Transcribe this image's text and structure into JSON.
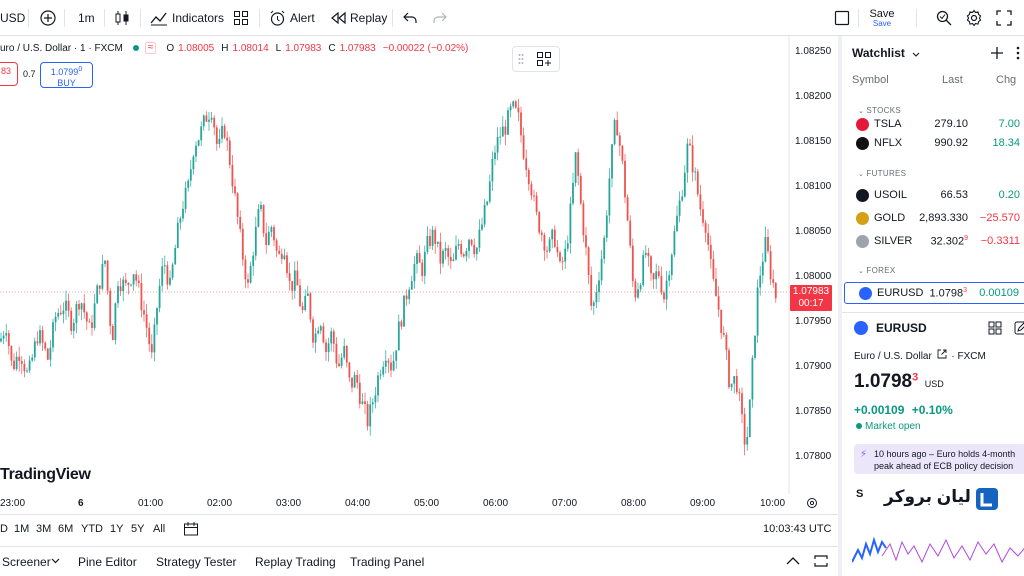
{
  "toolbar": {
    "symbol": "USD",
    "interval": "1m",
    "indicators": "Indicators",
    "alert": "Alert",
    "replay": "Replay",
    "save": "Save",
    "save_sub": "Save"
  },
  "legend": {
    "title": "uro / U.S. Dollar · 1 · FXCM",
    "o_label": "O",
    "o": "1.08005",
    "h_label": "H",
    "h": "1.08014",
    "l_label": "L",
    "l": "1.07983",
    "c_label": "C",
    "c": "1.07983",
    "change": "−0.00022 (−0.02%)"
  },
  "trade": {
    "sell_price": "83",
    "spread": "0.7",
    "buy_price": "1.0799",
    "buy_sup": "0",
    "buy_label": "BUY"
  },
  "brand": "TradingView",
  "price_axis": [
    "1.08250",
    "1.08200",
    "1.08150",
    "1.08100",
    "1.08050",
    "1.08000",
    "1.07950",
    "1.07900",
    "1.07850",
    "1.07800"
  ],
  "current_price": {
    "value": "1.07983",
    "countdown": "00:17"
  },
  "time_axis": [
    "23:00",
    "6",
    "01:00",
    "02:00",
    "03:00",
    "04:00",
    "05:00",
    "06:00",
    "07:00",
    "08:00",
    "09:00",
    "10:00"
  ],
  "ranges": [
    "D",
    "1M",
    "3M",
    "6M",
    "YTD",
    "1Y",
    "5Y",
    "All"
  ],
  "clock": "10:03:43 UTC",
  "panel_tabs": [
    "Screener",
    "Pine Editor",
    "Strategy Tester",
    "Replay Trading",
    "Trading Panel"
  ],
  "watchlist": {
    "title": "Watchlist",
    "col_symbol": "Symbol",
    "col_last": "Last",
    "col_chg": "Chg",
    "groups": {
      "stocks": "STOCKS",
      "futures": "FUTURES",
      "forex": "FOREX"
    },
    "rows": [
      {
        "symbol": "TSLA",
        "last": "279.10",
        "chg": "7.00",
        "dir": "up",
        "color": "#e31937"
      },
      {
        "symbol": "NFLX",
        "last": "990.92",
        "chg": "18.34",
        "dir": "up",
        "color": "#111111"
      },
      {
        "symbol": "USOIL",
        "last": "66.53",
        "chg": "0.20",
        "dir": "up",
        "color": "#131722"
      },
      {
        "symbol": "GOLD",
        "last": "2,893.330",
        "chg": "−25.570",
        "dir": "down",
        "color": "#d4a017"
      },
      {
        "symbol": "SILVER",
        "last": "32.302",
        "last_sup": "9",
        "chg": "−0.3311",
        "dir": "down",
        "color": "#9ea3ae"
      },
      {
        "symbol": "EURUSD",
        "last": "1.0798",
        "last_sup": "3",
        "chg": "0.00109",
        "dir": "up",
        "color": "#2962ff"
      }
    ]
  },
  "detail": {
    "symbol": "EURUSD",
    "name": "Euro / U.S. Dollar",
    "exchange": "FXCM",
    "price": "1.0798",
    "price_sup": "3",
    "currency": "USD",
    "change": "+0.00109",
    "change_pct": "+0.10%",
    "status": "Market open"
  },
  "news": {
    "time": "10 hours ago",
    "headline": "Euro holds 4-month peak ahead of ECB policy decision"
  },
  "ad": {
    "text": "لیان بروکر",
    "letter": "S"
  },
  "chart_data": {
    "type": "candlestick",
    "symbol": "EURUSD",
    "interval": "1m",
    "y_range": [
      1.0776,
      1.0827
    ],
    "current": 1.07983,
    "path": [
      [
        0,
        1.0793
      ],
      [
        6,
        1.0795
      ],
      [
        12,
        1.079
      ],
      [
        20,
        1.0792
      ],
      [
        28,
        1.0789
      ],
      [
        38,
        1.0794
      ],
      [
        48,
        1.0791
      ],
      [
        56,
        1.0796
      ],
      [
        64,
        1.0797
      ],
      [
        72,
        1.0795
      ],
      [
        80,
        1.0798
      ],
      [
        90,
        1.0794
      ],
      [
        98,
        1.0799
      ],
      [
        105,
        1.0802
      ],
      [
        112,
        1.0793
      ],
      [
        118,
        1.08
      ],
      [
        126,
        1.0799
      ],
      [
        134,
        1.0801
      ],
      [
        140,
        1.0798
      ],
      [
        146,
        1.0795
      ],
      [
        152,
        1.0791
      ],
      [
        158,
        1.0798
      ],
      [
        164,
        1.0802
      ],
      [
        170,
        1.0799
      ],
      [
        176,
        1.0804
      ],
      [
        182,
        1.0808
      ],
      [
        188,
        1.081
      ],
      [
        194,
        1.0815
      ],
      [
        200,
        1.0816
      ],
      [
        206,
        1.0818
      ],
      [
        212,
        1.0819
      ],
      [
        218,
        1.0814
      ],
      [
        224,
        1.0817
      ],
      [
        230,
        1.0813
      ],
      [
        236,
        1.0808
      ],
      [
        242,
        1.0803
      ],
      [
        248,
        1.0799
      ],
      [
        254,
        1.0804
      ],
      [
        260,
        1.0808
      ],
      [
        266,
        1.0804
      ],
      [
        272,
        1.0806
      ],
      [
        278,
        1.0802
      ],
      [
        284,
        1.0804
      ],
      [
        290,
        1.0799
      ],
      [
        296,
        1.08
      ],
      [
        302,
        1.0796
      ],
      [
        308,
        1.0798
      ],
      [
        314,
        1.0793
      ],
      [
        320,
        1.0796
      ],
      [
        326,
        1.0792
      ],
      [
        332,
        1.0794
      ],
      [
        338,
        1.079
      ],
      [
        344,
        1.0792
      ],
      [
        350,
        1.0788
      ],
      [
        356,
        1.0789
      ],
      [
        362,
        1.0786
      ],
      [
        368,
        1.0784
      ],
      [
        374,
        1.0787
      ],
      [
        380,
        1.079
      ],
      [
        386,
        1.0792
      ],
      [
        392,
        1.079
      ],
      [
        398,
        1.0794
      ],
      [
        404,
        1.0797
      ],
      [
        410,
        1.08
      ],
      [
        416,
        1.0802
      ],
      [
        422,
        1.0801
      ],
      [
        428,
        1.0804
      ],
      [
        434,
        1.0805
      ],
      [
        440,
        1.0802
      ],
      [
        446,
        1.0803
      ],
      [
        452,
        1.0801
      ],
      [
        458,
        1.0804
      ],
      [
        464,
        1.0803
      ],
      [
        470,
        1.0805
      ],
      [
        476,
        1.0803
      ],
      [
        482,
        1.0806
      ],
      [
        488,
        1.0809
      ],
      [
        494,
        1.0814
      ],
      [
        500,
        1.0816
      ],
      [
        506,
        1.0817
      ],
      [
        512,
        1.0819
      ],
      [
        518,
        1.0818
      ],
      [
        524,
        1.0814
      ],
      [
        530,
        1.0811
      ],
      [
        536,
        1.0807
      ],
      [
        542,
        1.0805
      ],
      [
        548,
        1.0803
      ],
      [
        554,
        1.0805
      ],
      [
        560,
        1.0801
      ],
      [
        566,
        1.0803
      ],
      [
        572,
        1.0809
      ],
      [
        576,
        1.0814
      ],
      [
        580,
        1.0809
      ],
      [
        586,
        1.0803
      ],
      [
        592,
        1.0796
      ],
      [
        598,
        1.08
      ],
      [
        604,
        1.0804
      ],
      [
        610,
        1.0812
      ],
      [
        616,
        1.0818
      ],
      [
        622,
        1.0813
      ],
      [
        628,
        1.0806
      ],
      [
        634,
        1.0798
      ],
      [
        640,
        1.08
      ],
      [
        646,
        1.0803
      ],
      [
        652,
        1.0799
      ],
      [
        658,
        1.0801
      ],
      [
        664,
        1.0798
      ],
      [
        670,
        1.0802
      ],
      [
        676,
        1.0806
      ],
      [
        682,
        1.081
      ],
      [
        688,
        1.0815
      ],
      [
        694,
        1.0812
      ],
      [
        700,
        1.0808
      ],
      [
        706,
        1.0806
      ],
      [
        712,
        1.08
      ],
      [
        718,
        1.0797
      ],
      [
        724,
        1.0793
      ],
      [
        730,
        1.0788
      ],
      [
        736,
        1.0789
      ],
      [
        742,
        1.0784
      ],
      [
        746,
        1.0781
      ],
      [
        750,
        1.0786
      ],
      [
        754,
        1.0793
      ],
      [
        758,
        1.0799
      ],
      [
        762,
        1.0802
      ],
      [
        766,
        1.0804
      ],
      [
        770,
        1.0801
      ],
      [
        776,
        1.0798
      ]
    ]
  }
}
